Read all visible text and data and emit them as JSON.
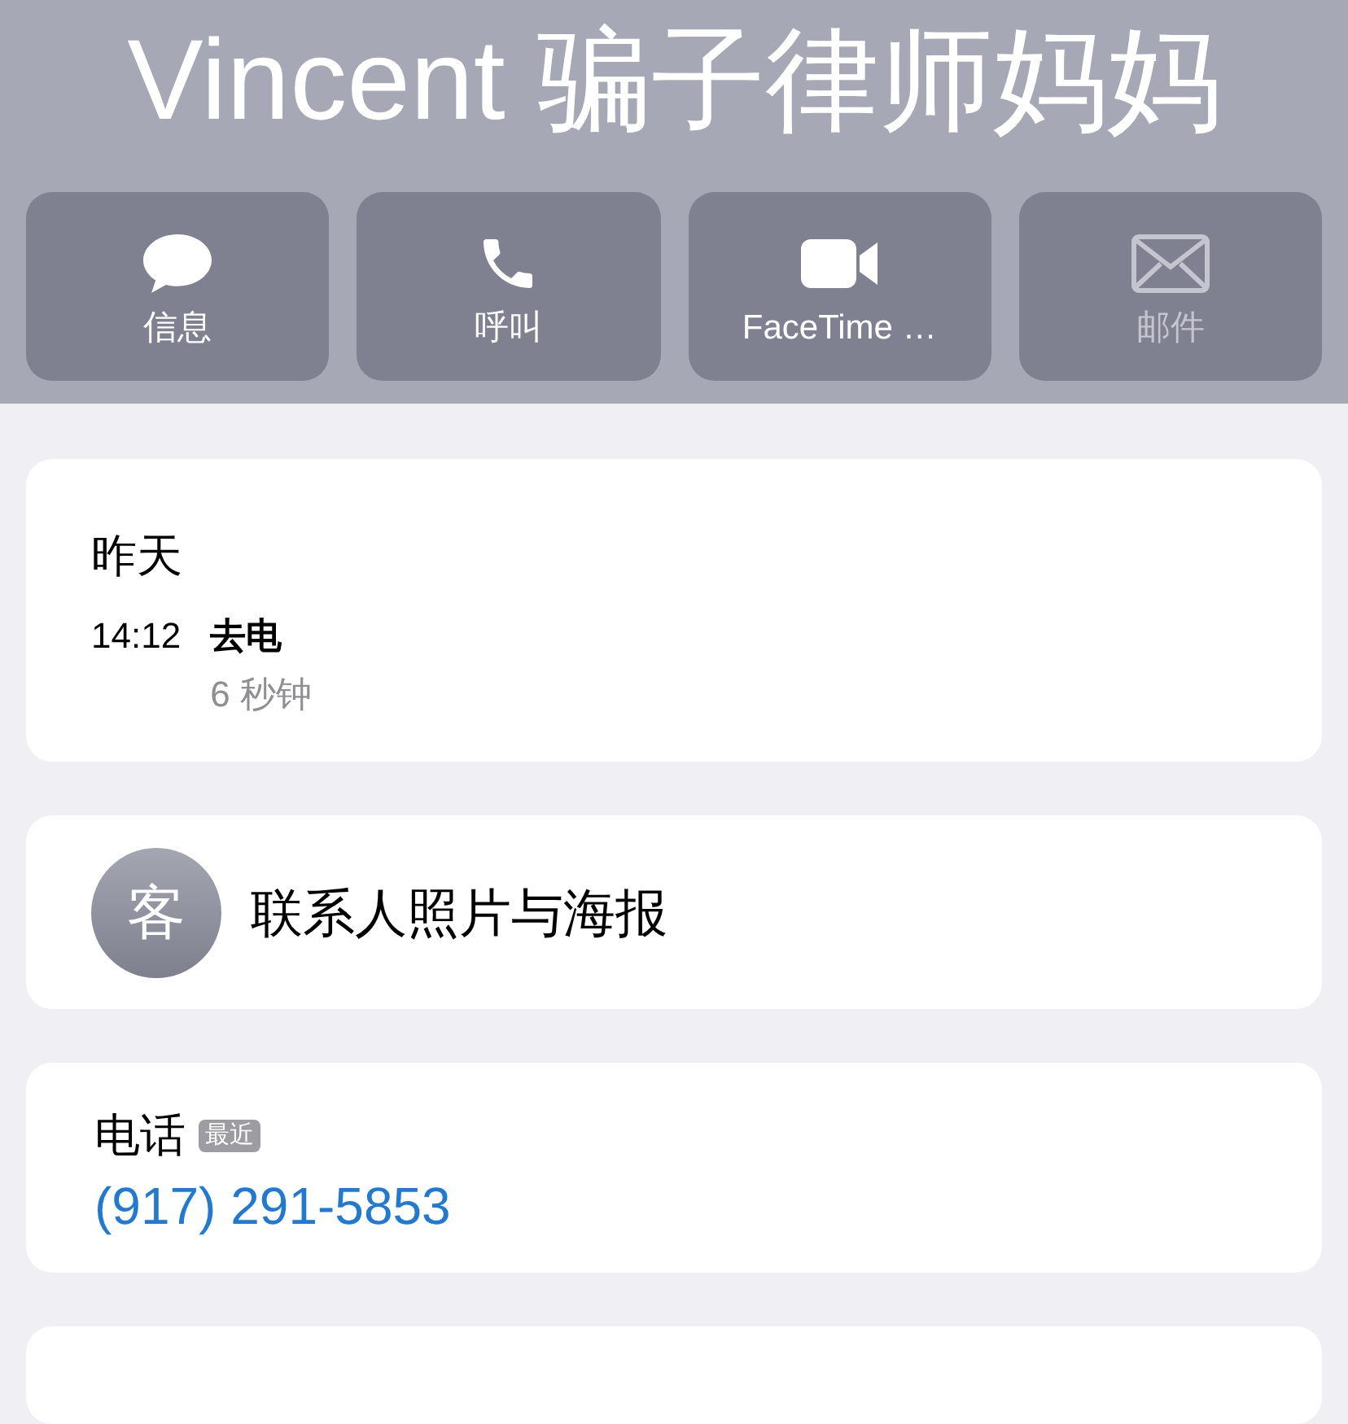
{
  "contact": {
    "name": "Vincent 骗子律师妈妈"
  },
  "actions": [
    {
      "kind": "message",
      "label": "信息",
      "disabled": false
    },
    {
      "kind": "call",
      "label": "呼叫",
      "disabled": false
    },
    {
      "kind": "video",
      "label": "FaceTime …",
      "disabled": false
    },
    {
      "kind": "mail",
      "label": "邮件",
      "disabled": true
    }
  ],
  "recents": {
    "day": "昨天",
    "entries": [
      {
        "time": "14:12",
        "type": "去电",
        "duration": "6 秒钟"
      }
    ]
  },
  "poster": {
    "avatar": "客",
    "label": "联系人照片与海报"
  },
  "phone": {
    "label": "电话",
    "badge": "最近",
    "number": "(917) 291-5853"
  }
}
